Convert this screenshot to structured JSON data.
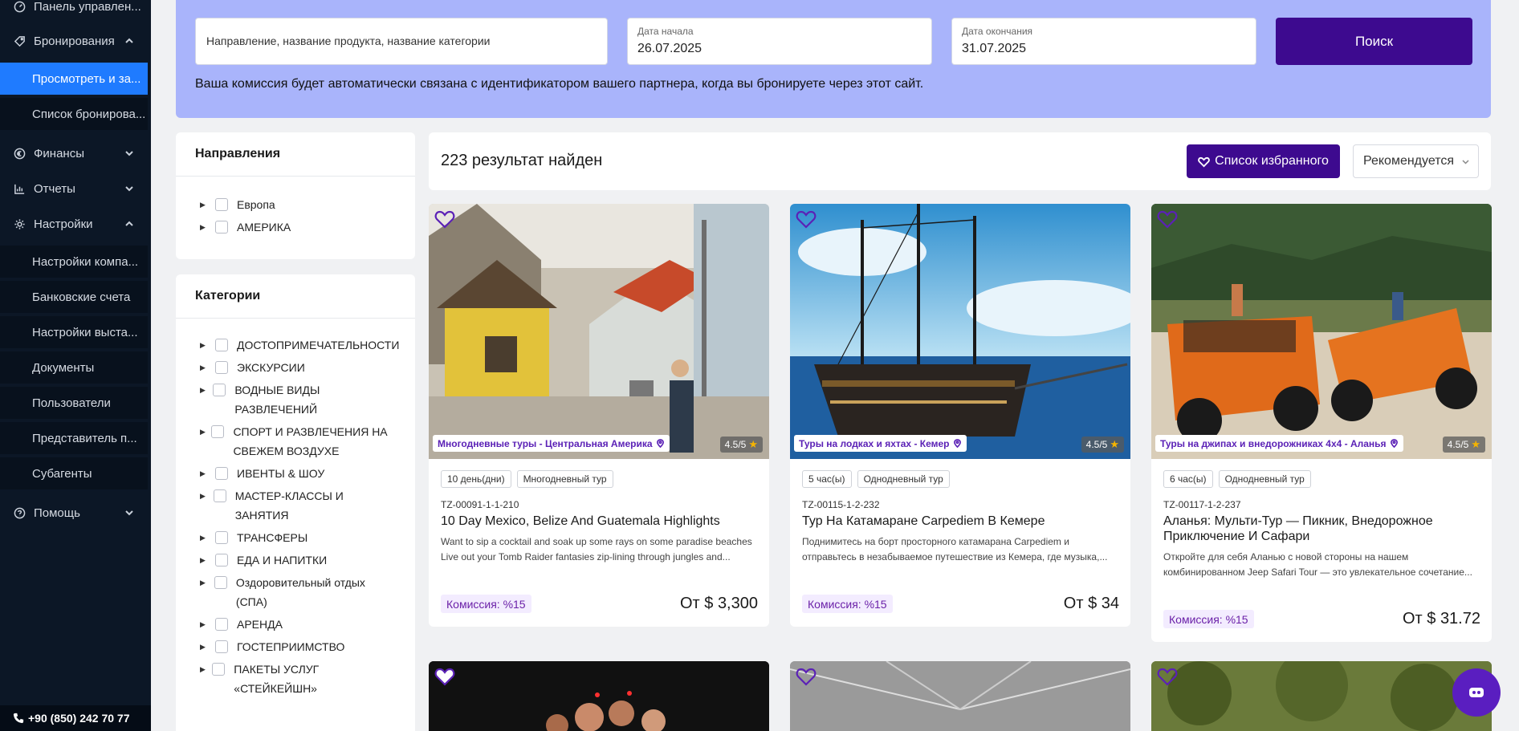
{
  "sidebar": {
    "items": [
      {
        "label": "Панель управлен...",
        "icon": "dashboard-icon"
      },
      {
        "label": "Бронирования",
        "icon": "tag-icon",
        "expanded": true
      },
      {
        "label": "Просмотреть и за...",
        "active": true
      },
      {
        "label": "Список бронирова..."
      },
      {
        "label": "Финансы",
        "icon": "euro-icon"
      },
      {
        "label": "Отчеты",
        "icon": "chart-icon"
      },
      {
        "label": "Настройки",
        "icon": "gear-icon",
        "expanded": true
      },
      {
        "label": "Настройки компа..."
      },
      {
        "label": "Банковские счета"
      },
      {
        "label": "Настройки выста..."
      },
      {
        "label": "Документы"
      },
      {
        "label": "Пользователи"
      },
      {
        "label": "Представитель п..."
      },
      {
        "label": "Субагенты"
      },
      {
        "label": "Помощь",
        "icon": "help-icon"
      }
    ],
    "phone": "+90 (850) 242 70 77"
  },
  "search": {
    "destination_placeholder": "Направление, название продукта, название категории",
    "start_label": "Дата начала",
    "start_value": "26.07.2025",
    "end_label": "Дата окончания",
    "end_value": "31.07.2025",
    "button": "Поиск",
    "note": "Ваша комиссия будет автоматически связана с идентификатором вашего партнера, когда вы бронируете через этот сайт."
  },
  "filters": {
    "directions_title": "Направления",
    "directions": [
      "Европа",
      "АМЕРИКА"
    ],
    "categories_title": "Категории",
    "categories": [
      "ДОСТОПРИМЕЧАТЕЛЬНОСТИ",
      "ЭКСКУРСИИ",
      "ВОДНЫЕ ВИДЫ РАЗВЛЕЧЕНИЙ",
      "СПОРТ И РАЗВЛЕЧЕНИЯ НА СВЕЖЕМ ВОЗДУХЕ",
      "ИВЕНТЫ & ШОУ",
      "МАСТЕР-КЛАССЫ И ЗАНЯТИЯ",
      "ТРАНСФЕРЫ",
      "ЕДА И НАПИТКИ",
      "Оздоровительный отдых (СПА)",
      "АРЕНДА",
      "ГОСТЕПРИИМСТВО",
      "ПАКЕТЫ УСЛУГ «СТЕЙКЕЙШН»"
    ]
  },
  "results": {
    "count": "223 результат найден",
    "favorites_button": "Список избранного",
    "sort": "Рекомендуется"
  },
  "cards": [
    {
      "category": "Многодневные туры - Центральная Америка",
      "rating": "4.5/5",
      "tag1": "10 день(дни)",
      "tag2": "Многодневный тур",
      "code": "TZ-00091-1-1-210",
      "title": "10 Day Mexico, Belize And Guatemala Highlights",
      "desc": "Want to sip a cocktail and soak up some rays on some paradise beaches Live out your Tomb Raider fantasies zip-lining through jungles and...",
      "commission": "Комиссия: %15",
      "price": "От $ 3,300"
    },
    {
      "category": "Туры на лодках и яхтах - Кемер",
      "rating": "4.5/5",
      "tag1": "5 час(ы)",
      "tag2": "Однодневный тур",
      "code": "TZ-00115-1-2-232",
      "title": "Тур На Катамаране Carpediem В Кемере",
      "desc": "Поднимитесь на борт просторного катамарана Carpediem и отправьтесь в незабываемое путешествие из Кемера, где музыка,...",
      "commission": "Комиссия: %15",
      "price": "От $ 34"
    },
    {
      "category": "Туры на джипах и внедорожниках 4х4 - Аланья",
      "rating": "4.5/5",
      "tag1": "6 час(ы)",
      "tag2": "Однодневный тур",
      "code": "TZ-00117-1-2-237",
      "title": "Аланья: Мульти-Тур — Пикник, Внедорожное Приключение И Сафари",
      "desc": "Откройте для себя Аланью с новой стороны на нашем комбинированном Jeep Safari Tour — это увлекательное сочетание...",
      "commission": "Комиссия: %15",
      "price": "От $ 31.72"
    }
  ],
  "colors": {
    "sidebar_bg": "#0c1726",
    "active_item": "#1f7bff",
    "search_panel": "#a9b4fb",
    "primary_button": "#3d0a8f",
    "accent_purple": "#5b21b6"
  }
}
